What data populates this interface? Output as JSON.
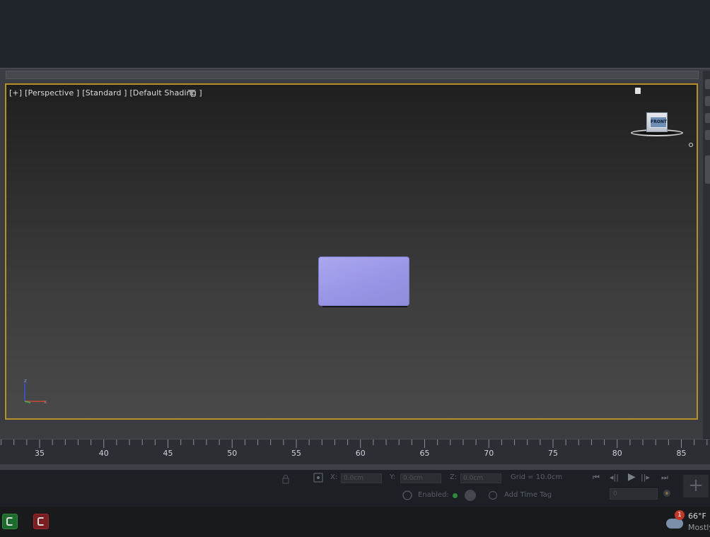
{
  "viewport": {
    "labels": [
      "[+]",
      "[Perspective ]",
      "[Standard ]",
      "[Default Shading ]"
    ],
    "viewcube_face": "FRONT"
  },
  "axis": {
    "z_label": "z",
    "x_label": "x"
  },
  "timeline": {
    "tick_labels": [
      "35",
      "40",
      "45",
      "50",
      "55",
      "60",
      "65",
      "70",
      "75",
      "80",
      "85"
    ]
  },
  "status": {
    "x_label": "X:",
    "x_value": "0.0cm",
    "y_label": "Y:",
    "y_value": "0.0cm",
    "z_label": "Z:",
    "z_value": "0.0cm",
    "grid": "Grid = 10.0cm",
    "enabled_label": "Enabled:",
    "add_time_tag": "Add Time Tag",
    "frame_value": "0"
  },
  "playback": {
    "go_start": "⏮",
    "prev": "◂||",
    "play": "▶",
    "next": "||▸",
    "go_end": "⏭"
  },
  "taskbar": {
    "weather_badge": "1",
    "temperature": "66°F",
    "condition": "Mostly"
  },
  "colors": {
    "viewport_border": "#b78f2c",
    "object": "#9c99e8",
    "accent_green": "#1d6b2c",
    "accent_red": "#7a1e22"
  },
  "icons": [
    "filter-icon",
    "lock-icon",
    "home-icon",
    "lock-selection-icon",
    "snap-icon",
    "key-icon",
    "tag-icon",
    "plus-icon"
  ]
}
